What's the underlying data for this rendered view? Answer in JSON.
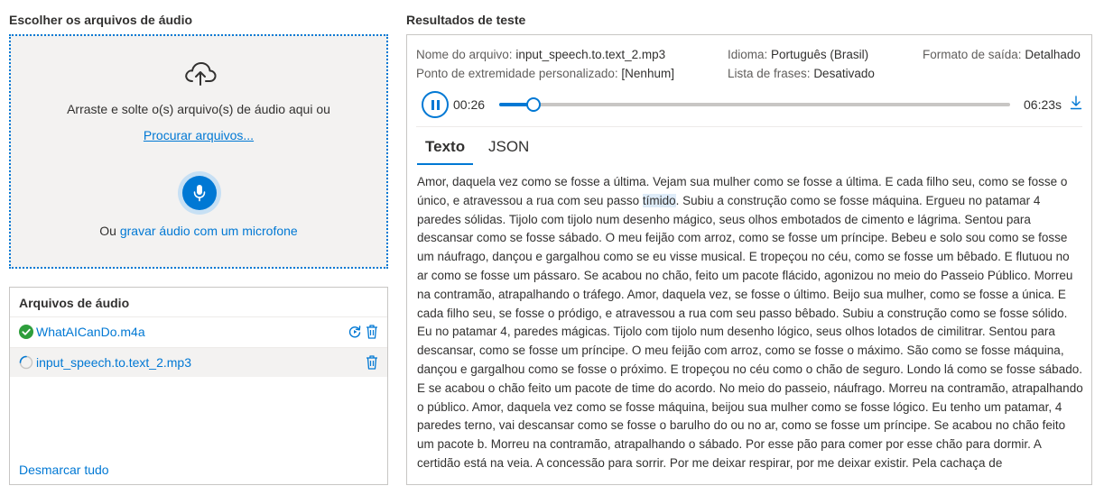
{
  "left_title": "Escolher os arquivos de áudio",
  "right_title": "Resultados de teste",
  "dropzone": {
    "instruction": "Arraste e solte o(s) arquivo(s) de áudio aqui ou",
    "browse_link": "Procurar arquivos...",
    "record_prefix": "Ou ",
    "record_link": "gravar áudio com um microfone",
    "upload_icon": "cloud-upload-icon",
    "mic_icon": "microphone-icon"
  },
  "files": {
    "title": "Arquivos de áudio",
    "items": [
      {
        "name": "WhatAICanDo.m4a",
        "status": "done",
        "status_icon": "check-circle-icon"
      },
      {
        "name": "input_speech.to.text_2.mp3",
        "status": "loading",
        "status_icon": "spinner-icon"
      }
    ],
    "unselect_all": "Desmarcar tudo"
  },
  "results": {
    "meta": {
      "file_label": "Nome do arquivo:",
      "file_value": "input_speech.to.text_2.mp3",
      "language_label": "Idioma:",
      "language_value": "Português (Brasil)",
      "output_label": "Formato de saída:",
      "output_value": "Detalhado",
      "endpoint_label": "Ponto de extremidade personalizado:",
      "endpoint_value": "[Nenhum]",
      "phrases_label": "Lista de frases:",
      "phrases_value": "Desativado"
    },
    "player": {
      "current_time": "00:26",
      "total_time": "06:23s",
      "progress": 0.068
    },
    "tabs": [
      {
        "label": "Texto",
        "active": true
      },
      {
        "label": "JSON",
        "active": false
      }
    ],
    "transcript_before": "Amor, daquela vez como se fosse a última. Vejam sua mulher como se fosse a última. E cada filho seu, como se fosse o único, e atravessou a rua com seu passo ",
    "transcript_highlight": "tímido",
    "transcript_after": ". Subiu a construção como se fosse máquina. Ergueu no patamar 4 paredes sólidas. Tijolo com tijolo num desenho mágico, seus olhos embotados de cimento e lágrima. Sentou para descansar como se fosse sábado. O meu feijão com arroz, como se fosse um príncipe. Bebeu e solo sou como se fosse um náufrago, dançou e gargalhou como se eu visse musical. E tropeçou no céu, como se fosse um bêbado. E flutuou no ar como se fosse um pássaro. Se acabou no chão, feito um pacote flácido, agonizou no meio do Passeio Público. Morreu na contramão, atrapalhando o tráfego. Amor, daquela vez, se fosse o último. Beijo sua mulher, como se fosse a única. E cada filho seu, se fosse o pródigo, e atravessou a rua com seu passo bêbado. Subiu a construção como se fosse sólido. Eu no patamar 4, paredes mágicas. Tijolo com tijolo num desenho lógico, seus olhos lotados de cimilitrar. Sentou para descansar, como se fosse um príncipe. O meu feijão com arroz, como se fosse o máximo. São como se fosse máquina, dançou e gargalhou como se fosse o próximo. E tropeçou no céu como o chão de seguro. Londo lá como se fosse sábado. E se acabou o chão feito um pacote de time do acordo. No meio do passeio, náufrago. Morreu na contramão, atrapalhando o público. Amor, daquela vez como se fosse máquina, beijou sua mulher como se fosse lógico. Eu tenho um patamar, 4 paredes terno, vai descansar como se fosse o barulho do ou no ar, como se fosse um príncipe. Se acabou no chão feito um pacote b. Morreu na contramão, atrapalhando o sábado. Por esse pão para comer por esse chão para dormir. A certidão está na veia. A concessão para sorrir. Por me deixar respirar, por me deixar existir. Pela cachaça de"
  },
  "colors": {
    "accent": "#0078d4",
    "success": "#2e9e3c",
    "dropzone_bg": "#f3f2f1",
    "highlight_bg": "#deecf9"
  }
}
